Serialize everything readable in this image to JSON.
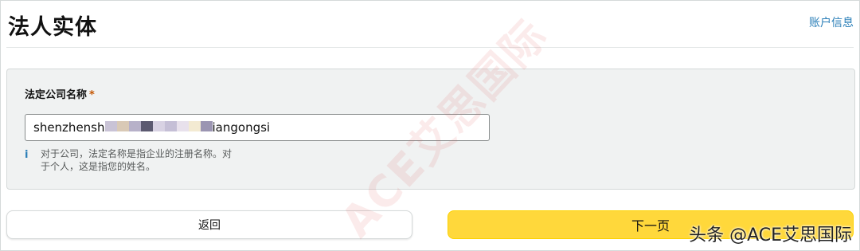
{
  "header": {
    "title": "法人实体",
    "account_link": "账户信息"
  },
  "form": {
    "label": "法定公司名称",
    "required_mark": "*",
    "input_prefix": "shenzhensh",
    "input_suffix": "iangongsi",
    "mask_colors": [
      "#c9c3d6",
      "#d9c9b6",
      "#b7b1c9",
      "#5b5970",
      "#d8d2e3",
      "#c5bfd6",
      "#e8e1ec",
      "#f3ead2",
      "#9b95b2"
    ],
    "hint_icon": "info-icon",
    "hint": "对于公司，法定名称是指企业的注册名称。对于个人，这是指您的姓名。"
  },
  "buttons": {
    "back": "返回",
    "next": "下一页"
  },
  "watermarks": {
    "diagonal": "ACE艾思国际",
    "corner": "头条 @ACE艾思国际"
  }
}
